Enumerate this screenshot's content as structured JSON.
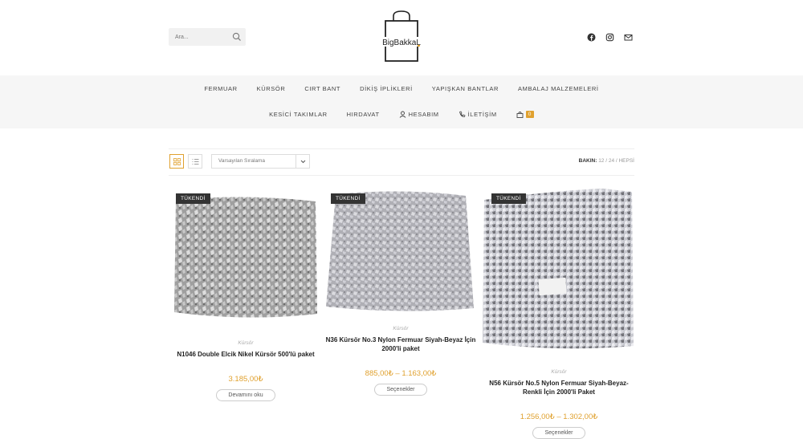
{
  "search": {
    "placeholder": "Ara..."
  },
  "logo": {
    "text": "BigBakkaL"
  },
  "social_icons": [
    "facebook-icon",
    "instagram-icon",
    "mail-icon"
  ],
  "nav": {
    "row1": [
      "FERMUAR",
      "KÜRSÖR",
      "CIRT BANT",
      "DİKİŞ İPLİKLERİ",
      "YAPIŞKAN BANTLAR",
      "AMBALAJ MALZEMELERİ"
    ],
    "row2": [
      "KESİCİ TAKIMLAR",
      "HIRDAVAT",
      "HESABIM",
      "İLETİŞİM"
    ],
    "cart_count": "0"
  },
  "toolbar": {
    "sort_value": "Varsayılan Sıralama",
    "bakin_label": "BAKIN:",
    "bakin_options": "12 / 24 / HEPSİ"
  },
  "products": [
    {
      "badge": "TÜKENDİ",
      "category": "Kürsör",
      "name": "N1046 Double Elcik Nikel Kürsör 500'lü paket",
      "price": "3.185,00₺",
      "button": "Devamını oku"
    },
    {
      "badge": "TÜKENDİ",
      "category": "Kürsör",
      "name": "N36 Kürsör No.3 Nylon Fermuar Siyah-Beyaz İçin 2000'li paket",
      "price": "885,00₺ – 1.163,00₺",
      "button": "Seçenekler"
    },
    {
      "badge": "TÜKENDİ",
      "category": "Kürsör",
      "name": "N56 Kürsör No.5 Nylon Fermuar Siyah-Beyaz-Renkli İçin 2000'li Paket",
      "price": "1.256,00₺ – 1.302,00₺",
      "button": "Seçenekler"
    }
  ],
  "colors": {
    "accent": "#e0a12f",
    "nav_bg": "#f6f6f6",
    "badge_bg": "#333333"
  }
}
